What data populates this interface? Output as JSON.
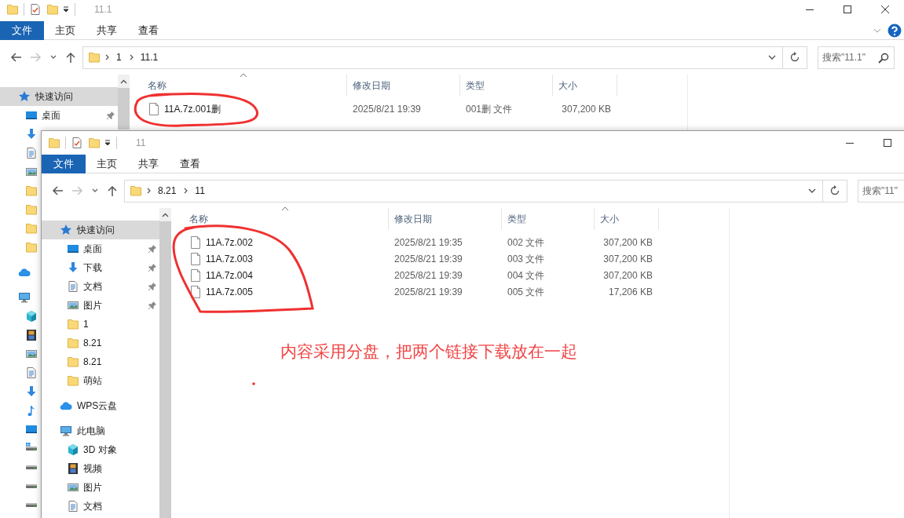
{
  "windows": [
    {
      "title": "11.1",
      "window_buttons": [
        {
          "kind": "minimize"
        },
        {
          "kind": "maximize"
        },
        {
          "kind": "close"
        }
      ],
      "ribbon_help": true,
      "ribbon_tabs": [
        {
          "label": "文件",
          "selected": true
        },
        {
          "label": "主页",
          "selected": false
        },
        {
          "label": "共享",
          "selected": false
        },
        {
          "label": "查看",
          "selected": false
        }
      ],
      "path": [
        "1",
        "11.1"
      ],
      "search": {
        "placeholder": "搜索\"11.1\"",
        "icon": true
      },
      "sidebar": [
        {
          "kind": "star",
          "label": "快速访问",
          "selected": true,
          "pinned": false,
          "children": [
            {
              "kind": "desktop",
              "label": "桌面",
              "selected": false,
              "pinned": true
            },
            {
              "kind": "download",
              "selected": false,
              "pinned": false
            },
            {
              "kind": "document",
              "selected": false,
              "pinned": false
            },
            {
              "kind": "picture",
              "selected": false,
              "pinned": false
            },
            {
              "kind": "folder",
              "selected": false,
              "pinned": false
            },
            {
              "kind": "folder",
              "selected": false,
              "pinned": false
            },
            {
              "kind": "folder",
              "selected": false,
              "pinned": false
            },
            {
              "kind": "folder",
              "selected": false,
              "pinned": false
            }
          ]
        },
        {
          "kind": "cloud",
          "selected": false,
          "pinned": false
        },
        {
          "kind": "pc",
          "selected": false,
          "pinned": false,
          "children": [
            {
              "kind": "cube",
              "selected": false,
              "pinned": false
            },
            {
              "kind": "video",
              "selected": false,
              "pinned": false
            },
            {
              "kind": "picture",
              "selected": false,
              "pinned": false
            },
            {
              "kind": "document",
              "selected": false,
              "pinned": false
            },
            {
              "kind": "download",
              "selected": false,
              "pinned": false
            },
            {
              "kind": "music",
              "selected": false,
              "pinned": false
            },
            {
              "kind": "desktop",
              "selected": false,
              "pinned": false
            },
            {
              "kind": "windrive",
              "selected": false,
              "pinned": false
            },
            {
              "kind": "drive",
              "selected": false,
              "pinned": false
            },
            {
              "kind": "drive",
              "selected": false,
              "pinned": false
            },
            {
              "kind": "drive",
              "selected": false,
              "pinned": false
            }
          ]
        }
      ],
      "columns": [
        "名称",
        "修改日期",
        "类型",
        "大小"
      ],
      "files": [
        {
          "name": "11A.7z.001删",
          "date": "2025/8/21 19:39",
          "type": "001删 文件",
          "size": "307,200 KB"
        }
      ]
    },
    {
      "title": "11",
      "window_buttons": [
        {
          "kind": "minimize"
        },
        {
          "kind": "maximize"
        }
      ],
      "ribbon_tabs": [
        {
          "label": "文件",
          "selected": true
        },
        {
          "label": "主页",
          "selected": false
        },
        {
          "label": "共享",
          "selected": false
        },
        {
          "label": "查看",
          "selected": false
        }
      ],
      "path": [
        "8.21",
        "11"
      ],
      "search": {
        "placeholder": "搜索\"11\""
      },
      "sidebar": [
        {
          "kind": "star",
          "label": "快速访问",
          "selected": true,
          "pinned": false,
          "children": [
            {
              "kind": "desktop",
              "label": "桌面",
              "selected": false,
              "pinned": true
            },
            {
              "kind": "download",
              "label": "下载",
              "selected": false,
              "pinned": true
            },
            {
              "kind": "document",
              "label": "文档",
              "selected": false,
              "pinned": true
            },
            {
              "kind": "picture",
              "label": "图片",
              "selected": false,
              "pinned": true
            },
            {
              "kind": "folder",
              "label": "1",
              "selected": false,
              "pinned": false
            },
            {
              "kind": "folder",
              "label": "8.21",
              "selected": false,
              "pinned": false
            },
            {
              "kind": "folder",
              "label": "8.21",
              "selected": false,
              "pinned": false
            },
            {
              "kind": "folder",
              "label": "萌站",
              "selected": false,
              "pinned": false
            }
          ]
        },
        {
          "kind": "cloud",
          "label": "WPS云盘",
          "selected": false,
          "pinned": false
        },
        {
          "kind": "pc",
          "label": "此电脑",
          "selected": false,
          "pinned": false,
          "children": [
            {
              "kind": "cube",
              "label": "3D 对象",
              "selected": false,
              "pinned": false
            },
            {
              "kind": "video",
              "label": "视频",
              "selected": false,
              "pinned": false
            },
            {
              "kind": "picture",
              "label": "图片",
              "selected": false,
              "pinned": false
            },
            {
              "kind": "document",
              "label": "文档",
              "selected": false,
              "pinned": false
            }
          ]
        }
      ],
      "columns": [
        "名称",
        "修改日期",
        "类型",
        "大小"
      ],
      "files": [
        {
          "name": "11A.7z.002",
          "date": "2025/8/21 19:35",
          "type": "002 文件",
          "size": "307,200 KB"
        },
        {
          "name": "11A.7z.003",
          "date": "2025/8/21 19:39",
          "type": "003 文件",
          "size": "307,200 KB"
        },
        {
          "name": "11A.7z.004",
          "date": "2025/8/21 19:39",
          "type": "004 文件",
          "size": "307,200 KB"
        },
        {
          "name": "11A.7z.005",
          "date": "2025/8/21 19:39",
          "type": "005 文件",
          "size": "17,206 KB"
        }
      ]
    }
  ],
  "annotation": {
    "note": "内容采用分盘，把两个链接下载放在一起"
  }
}
